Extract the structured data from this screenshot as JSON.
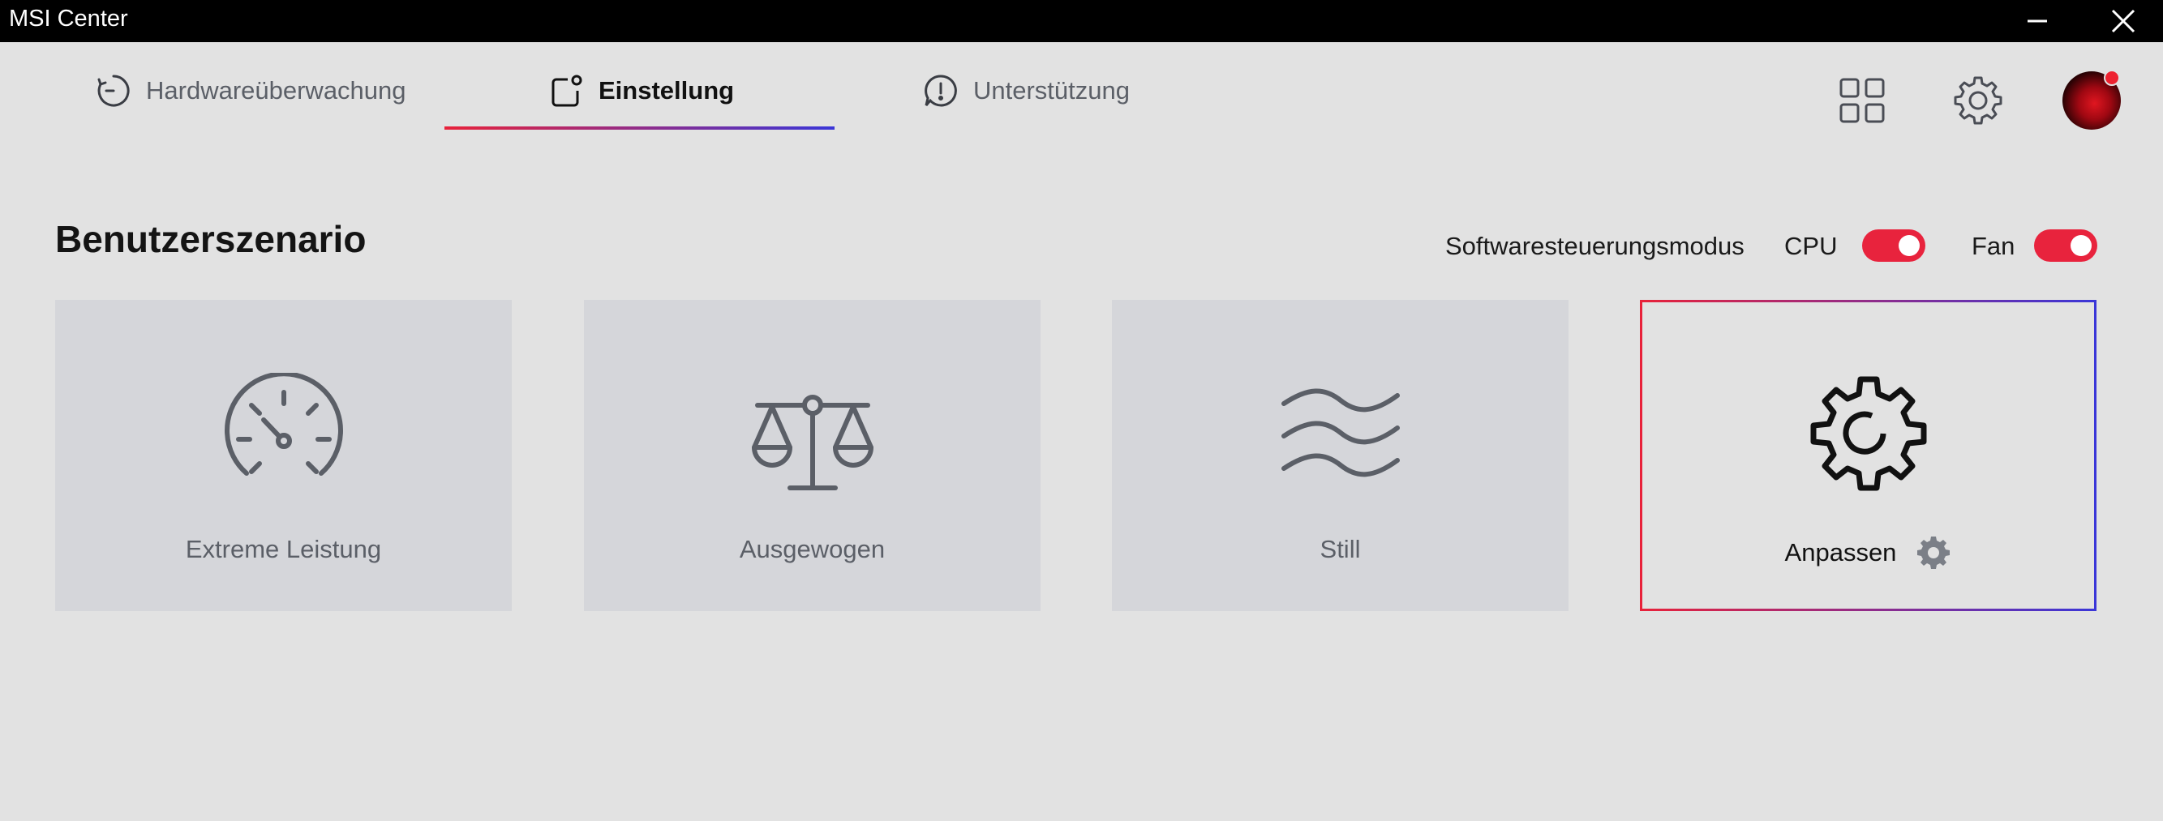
{
  "window": {
    "title": "MSI Center"
  },
  "nav": {
    "tabs": [
      {
        "label": "Hardwareüberwachung",
        "icon": "gauge-cycle-icon",
        "active": false
      },
      {
        "label": "Einstellung",
        "icon": "settings-square-icon",
        "active": true
      },
      {
        "label": "Unterstützung",
        "icon": "support-bubble-icon",
        "active": false
      }
    ]
  },
  "top_icons": [
    "apps-grid-icon",
    "gear-icon",
    "avatar"
  ],
  "section": {
    "title": "Benutzerszenario"
  },
  "controls": {
    "mode_label": "Softwaresteuerungsmodus",
    "cpu_label": "CPU",
    "cpu_on": true,
    "fan_label": "Fan",
    "fan_on": true
  },
  "scenarios": [
    {
      "label": "Extreme Leistung",
      "icon": "speedometer-icon",
      "selected": false
    },
    {
      "label": "Ausgewogen",
      "icon": "balance-scale-icon",
      "selected": false
    },
    {
      "label": "Still",
      "icon": "waves-icon",
      "selected": false
    },
    {
      "label": "Anpassen",
      "icon": "cog-icon",
      "selected": true
    }
  ],
  "colors": {
    "accent_red": "#e8233d",
    "accent_blue": "#3a36d8",
    "background": "#e2e2e2",
    "card": "#d5d6da"
  }
}
